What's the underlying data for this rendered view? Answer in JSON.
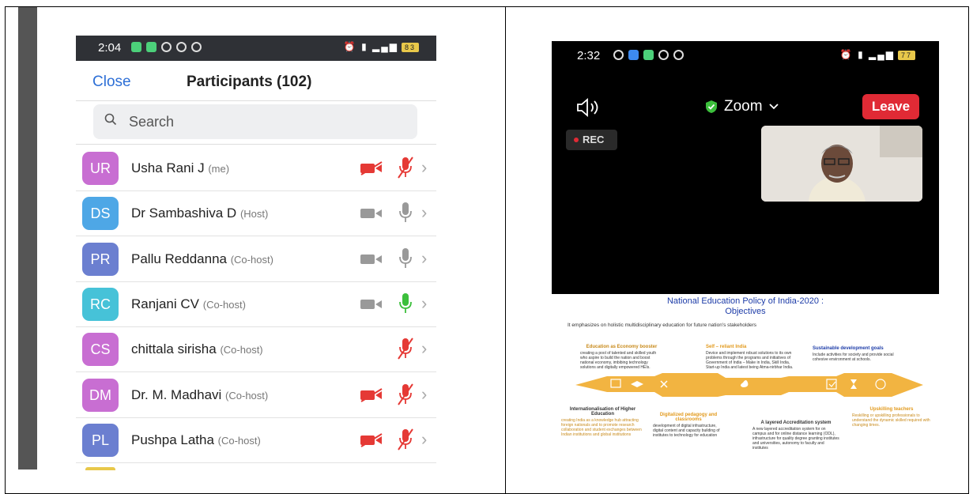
{
  "left_screen": {
    "status": {
      "time": "2:04",
      "battery": "83"
    },
    "header": {
      "close_label": "Close",
      "title": "Participants (102)"
    },
    "search": {
      "placeholder": "Search"
    },
    "participants": [
      {
        "initials": "UR",
        "name": "Usha Rani J",
        "role": "(me)",
        "color": "#c86ed2",
        "video": "off",
        "audio": "muted"
      },
      {
        "initials": "DS",
        "name": "Dr Sambashiva D",
        "role": "(Host)",
        "color": "#4ea7e6",
        "video": "on",
        "audio": "on"
      },
      {
        "initials": "PR",
        "name": "Pallu Reddanna",
        "role": "(Co-host)",
        "color": "#6b7fd0",
        "video": "on",
        "audio": "on"
      },
      {
        "initials": "RC",
        "name": "Ranjani CV",
        "role": "(Co-host)",
        "color": "#46c2d8",
        "video": "on",
        "audio": "speaking"
      },
      {
        "initials": "CS",
        "name": "chittala sirisha",
        "role": "(Co-host)",
        "color": "#c86ed2",
        "video": "none",
        "audio": "muted"
      },
      {
        "initials": "DM",
        "name": "Dr. M. Madhavi",
        "role": "(Co-host)",
        "color": "#c86ed2",
        "video": "off",
        "audio": "muted"
      },
      {
        "initials": "PL",
        "name": "Pushpa Latha",
        "role": "(Co-host)",
        "color": "#6b7fd0",
        "video": "off",
        "audio": "muted"
      }
    ]
  },
  "right_screen": {
    "status": {
      "time": "2:32",
      "battery": "77"
    },
    "meeting": {
      "app_label": "Zoom",
      "leave_label": "Leave",
      "rec_label": "REC"
    },
    "slide": {
      "title_line1": "National Education Policy of India-2020 :",
      "title_line2": "Objectives",
      "subtitle": "It emphasizes on holistic multidisciplinary education for future nation's stakeholders",
      "boxes": [
        {
          "head": "Education as Economy booster",
          "body": "creating a pool of talented and skilled youth who aspire to build the nation and boost national economy, imbibing technology solutions and digitally empowered HEIs."
        },
        {
          "head": "Self – reliant India",
          "body": "Device and implement robust solutions to its own problems through the programs and initiatives of Government of India – Make in India, Skill India, Start-up India and latest being Atma-nirbhar India."
        },
        {
          "head": "Sustainable development goals",
          "body": "Include activities for society and provide social cohesive environment at schools."
        },
        {
          "head": "Internationalisation of Higher Education",
          "body": "creating India as a knowledge hub attracting foreign nationals and to promote research collaboration and student exchanges between Indian institutions and global institutions"
        },
        {
          "head": "Digitalized pedagogy and classrooms",
          "body": "development of digital infrastructure, digital content and capacity building of institutes to technology for education"
        },
        {
          "head": "A layered Accreditation system",
          "body": "A new layered accreditation system for on campus and for online distance learning (ODL), infrastructure for quality degree granting institutes and universities, autonomy to faculty and institutes"
        },
        {
          "head": "Upskilling teachers",
          "body": "Reskilling or upskilling professionals to understand the dynamic skilled required with changing times."
        }
      ]
    }
  },
  "colors": {
    "accent_blue": "#2d6fd6",
    "leave_red": "#e02a35",
    "muted_red": "#e53935",
    "speaking_green": "#3cbf3c",
    "slide_orange": "#f2b441"
  }
}
